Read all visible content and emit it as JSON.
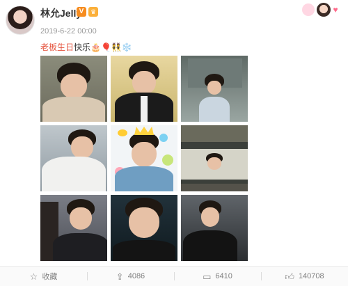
{
  "post": {
    "username": "林允Jelly",
    "verified_badge": "V",
    "member_badge_icon": "crown-icon",
    "timestamp": "2019-6-22 00:00",
    "text_highlight": "老板生日",
    "text_main": "快乐",
    "text_emoji": "🎂🎈👯❄️"
  },
  "footer": {
    "favorite_label": "收藏",
    "repost_count": "4086",
    "comment_count": "6410",
    "like_count": "140708"
  },
  "colors": {
    "highlight": "#e5533d",
    "verified": "#f68c1f"
  }
}
